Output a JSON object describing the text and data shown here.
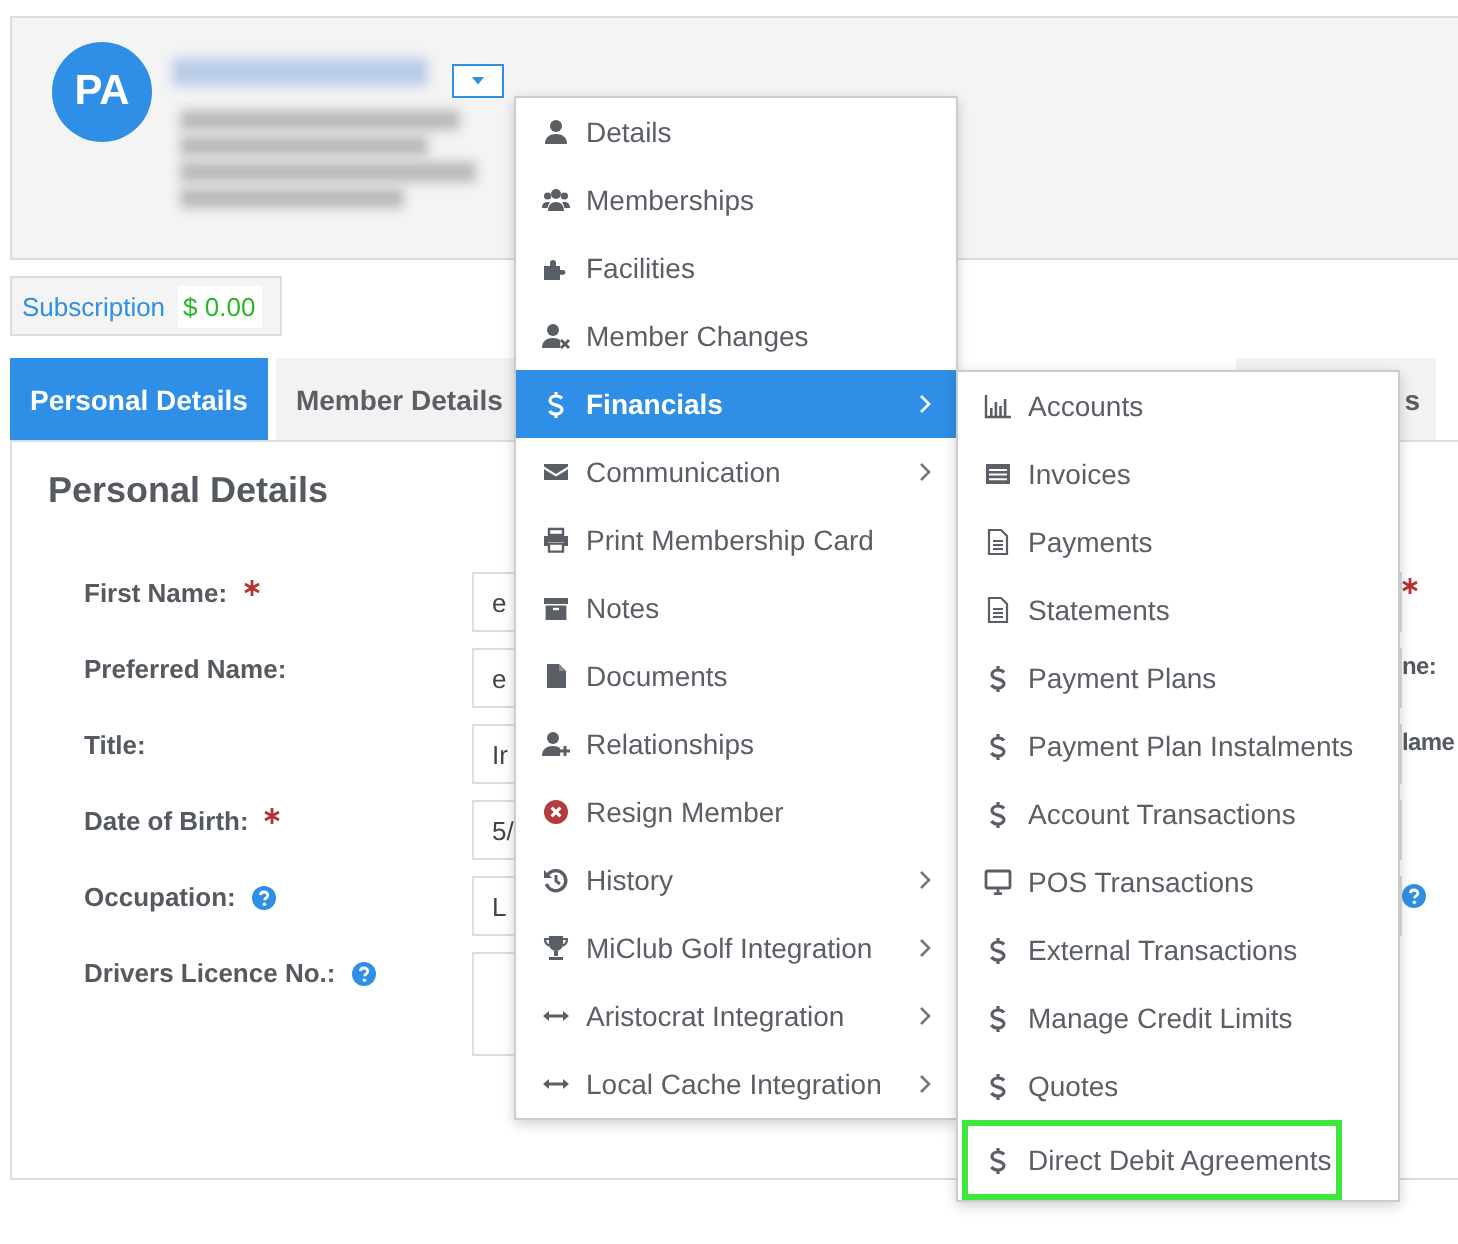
{
  "profile": {
    "initials": "PA",
    "menu_open": true
  },
  "subscription": {
    "label": "Subscription",
    "amount": "$ 0.00"
  },
  "tabs": [
    {
      "label": "Personal Details",
      "selected": true
    },
    {
      "label": "Member Details",
      "selected": false
    },
    {
      "label": "s",
      "selected": false
    }
  ],
  "section_title": "Personal Details",
  "fields": [
    {
      "label": "First Name:",
      "required": true,
      "help": false,
      "value": "e",
      "kind": "input",
      "right": {
        "kind": "required"
      }
    },
    {
      "label": "Preferred Name:",
      "required": false,
      "help": false,
      "value": "e",
      "kind": "input",
      "right": {
        "kind": "label",
        "text": "ne:"
      }
    },
    {
      "label": "Title:",
      "required": false,
      "help": false,
      "value": "Ir",
      "kind": "input",
      "right": {
        "kind": "label",
        "text": "lame"
      }
    },
    {
      "label": "Date of Birth:",
      "required": true,
      "help": false,
      "value": "5/",
      "kind": "input"
    },
    {
      "label": "Occupation:",
      "required": false,
      "help": true,
      "value": "L",
      "kind": "input",
      "right": {
        "kind": "help"
      }
    },
    {
      "label": "Drivers Licence No.:",
      "required": false,
      "help": true,
      "kind": "textarea"
    }
  ],
  "menu": [
    {
      "label": "Details",
      "selected": false,
      "submenu": false
    },
    {
      "label": "Memberships",
      "selected": false,
      "submenu": false
    },
    {
      "label": "Facilities",
      "selected": false,
      "submenu": false
    },
    {
      "label": "Member Changes",
      "selected": false,
      "submenu": false
    },
    {
      "label": "Financials",
      "selected": true,
      "submenu": true
    },
    {
      "label": "Communication",
      "selected": false,
      "submenu": true
    },
    {
      "label": "Print Membership Card",
      "selected": false,
      "submenu": false
    },
    {
      "label": "Notes",
      "selected": false,
      "submenu": false
    },
    {
      "label": "Documents",
      "selected": false,
      "submenu": false
    },
    {
      "label": "Relationships",
      "selected": false,
      "submenu": false
    },
    {
      "label": "Resign Member",
      "selected": false,
      "submenu": false
    },
    {
      "label": "History",
      "selected": false,
      "submenu": true
    },
    {
      "label": "MiClub Golf Integration",
      "selected": false,
      "submenu": true
    },
    {
      "label": "Aristocrat Integration",
      "selected": false,
      "submenu": true
    },
    {
      "label": "Local Cache Integration",
      "selected": false,
      "submenu": true
    }
  ],
  "submenu": [
    {
      "label": "Accounts",
      "highlighted": false
    },
    {
      "label": "Invoices",
      "highlighted": false
    },
    {
      "label": "Payments",
      "highlighted": false
    },
    {
      "label": "Statements",
      "highlighted": false
    },
    {
      "label": "Payment Plans",
      "highlighted": false
    },
    {
      "label": "Payment Plan Instalments",
      "highlighted": false
    },
    {
      "label": "Account Transactions",
      "highlighted": false
    },
    {
      "label": "POS Transactions",
      "highlighted": false
    },
    {
      "label": "External Transactions",
      "highlighted": false
    },
    {
      "label": "Manage Credit Limits",
      "highlighted": false
    },
    {
      "label": "Quotes",
      "highlighted": false
    },
    {
      "label": "Direct Debit Agreements",
      "highlighted": true
    }
  ]
}
